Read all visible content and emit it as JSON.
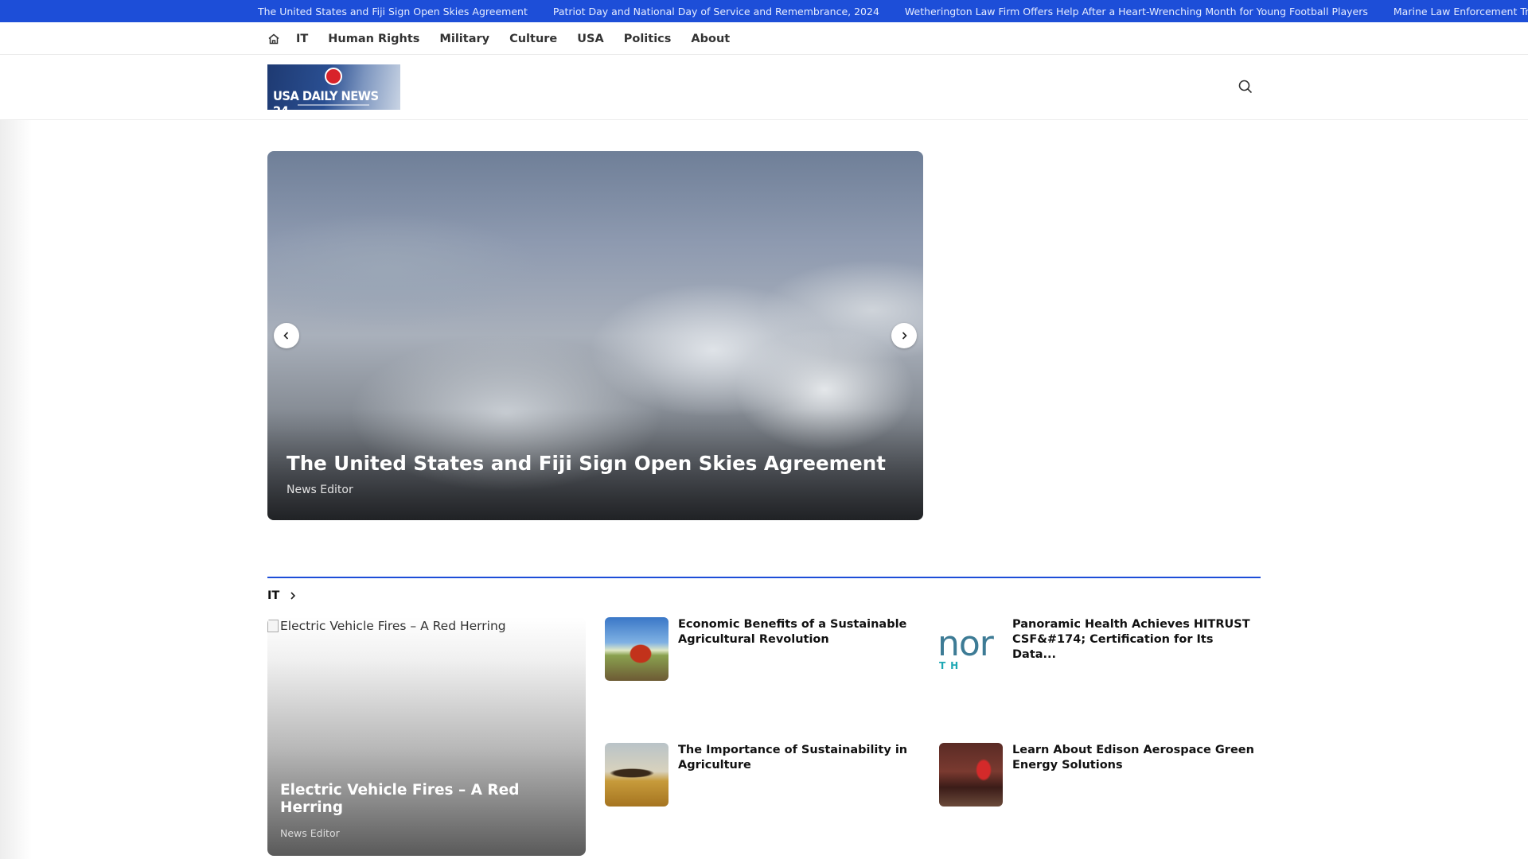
{
  "ticker": {
    "items": [
      "The United States and Fiji Sign Open Skies Agreement",
      "Patriot Day and National Day of Service and Remembrance, 2024",
      "Wetherington Law Firm Offers Help After a Heart-Wrenching Month for Young Football Players",
      "Marine Law Enforcement Training Pro"
    ]
  },
  "nav": {
    "home_icon": "home-icon",
    "links": [
      "IT",
      "Human Rights",
      "Military",
      "Culture",
      "USA",
      "Politics",
      "About"
    ]
  },
  "header": {
    "logo_text": "USA DAILY NEWS 24",
    "search_icon": "search-icon"
  },
  "hero": {
    "title": "The United States and Fiji Sign Open Skies Agreement",
    "author": "News Editor",
    "prev_icon": "chevron-left-icon",
    "next_icon": "chevron-right-icon"
  },
  "section": {
    "title": "IT",
    "accent": "#1d4ed8",
    "feature": {
      "image_alt": "Electric Vehicle Fires – A Red Herring",
      "title": "Electric Vehicle Fires – A Red Herring",
      "author": "News Editor"
    },
    "items": [
      {
        "title": "Economic Benefits of a Sustainable Agricultural Revolution"
      },
      {
        "title": "Panoramic Health Achieves HITRUST CSF&#174; Certification for Its Data..."
      },
      {
        "title": "The Importance of Sustainability in Agriculture"
      },
      {
        "title": "Learn About Edison Aerospace Green Energy Solutions"
      }
    ],
    "nor_logo_text": "nor",
    "nor_logo_sub": "TH"
  }
}
